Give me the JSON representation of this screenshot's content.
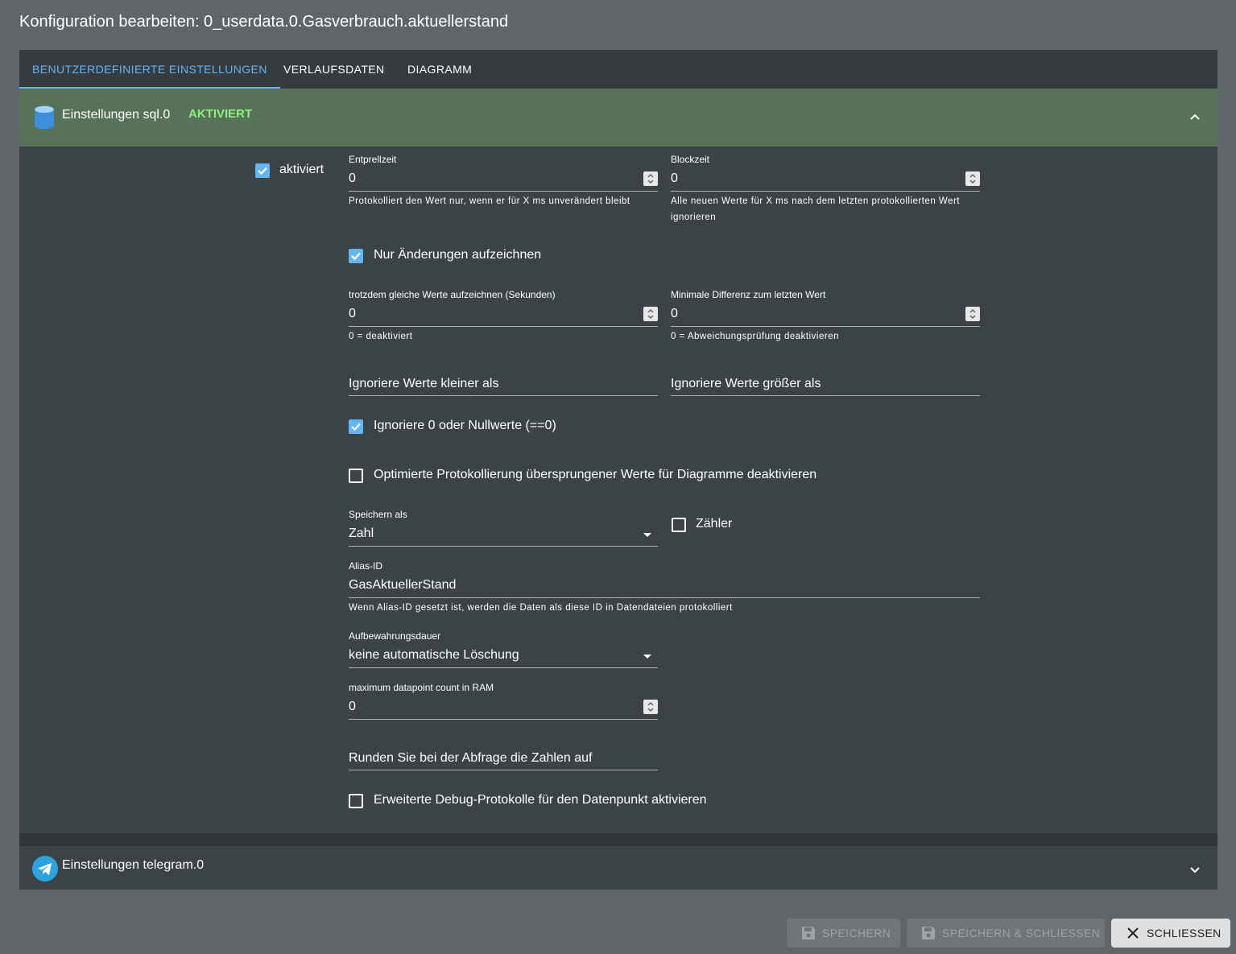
{
  "dialog": {
    "title": "Konfiguration bearbeiten: 0_userdata.0.Gasverbrauch.aktuellerstand"
  },
  "tabs": [
    {
      "label": "BENUTZERDEFINIERTE EINSTELLUNGEN",
      "active": true
    },
    {
      "label": "VERLAUFSDATEN",
      "active": false
    },
    {
      "label": "DIAGRAMM",
      "active": false
    }
  ],
  "sql_section": {
    "title": "Einstellungen sql.0",
    "status": "AKTIVIERT",
    "enabled_label": "aktiviert",
    "enabled": true,
    "entprellzeit": {
      "label": "Entprellzeit",
      "value": "0",
      "help": "Protokolliert den Wert nur, wenn er für X ms unverändert bleibt"
    },
    "blockzeit": {
      "label": "Blockzeit",
      "value": "0",
      "help": "Alle neuen Werte für X ms nach dem letzten protokollierten Wert ignorieren"
    },
    "nur_aenderungen": {
      "label": "Nur Änderungen aufzeichnen",
      "checked": true
    },
    "gleiche_werte": {
      "label": "trotzdem gleiche Werte aufzeichnen (Sekunden)",
      "value": "0",
      "help": "0 = deaktiviert"
    },
    "min_diff": {
      "label": "Minimale Differenz zum letzten Wert",
      "value": "0",
      "help": "0 = Abweichungsprüfung deaktivieren"
    },
    "ignore_less": {
      "placeholder": "Ignoriere Werte kleiner als"
    },
    "ignore_greater": {
      "placeholder": "Ignoriere Werte größer als"
    },
    "ignore_zero": {
      "label": "Ignoriere 0 oder Nullwerte (==0)",
      "checked": true
    },
    "disable_optimized": {
      "label": "Optimierte Protokollierung übersprungener Werte für Diagramme deaktivieren",
      "checked": false
    },
    "store_as": {
      "label": "Speichern als",
      "value": "Zahl"
    },
    "counter": {
      "label": "Zähler",
      "checked": false
    },
    "alias": {
      "label": "Alias-ID",
      "value": "GasAktuellerStand",
      "help": "Wenn Alias-ID gesetzt ist, werden die Daten als diese ID in Datendateien protokolliert"
    },
    "retention": {
      "label": "Aufbewahrungsdauer",
      "value": "keine automatische Löschung"
    },
    "max_datapoints": {
      "label": "maximum datapoint count in RAM",
      "value": "0"
    },
    "round": {
      "placeholder": "Runden Sie bei der Abfrage die Zahlen auf"
    },
    "debug": {
      "label": "Erweiterte Debug-Protokolle für den Datenpunkt aktivieren",
      "checked": false
    }
  },
  "telegram_section": {
    "title": "Einstellungen telegram.0"
  },
  "buttons": {
    "save": "SPEICHERN",
    "save_close": "SPEICHERN & SCHLIESSEN",
    "close": "SCHLIESSEN"
  },
  "colors": {
    "accent": "#64b5f6",
    "status_green": "#8ef07c",
    "header_green": "#587259"
  },
  "icons": [
    "database-icon",
    "chevron-up-icon",
    "checkbox-icon",
    "spin-icon",
    "dropdown-icon",
    "telegram-icon",
    "chevron-down-icon",
    "save-icon",
    "close-icon"
  ]
}
